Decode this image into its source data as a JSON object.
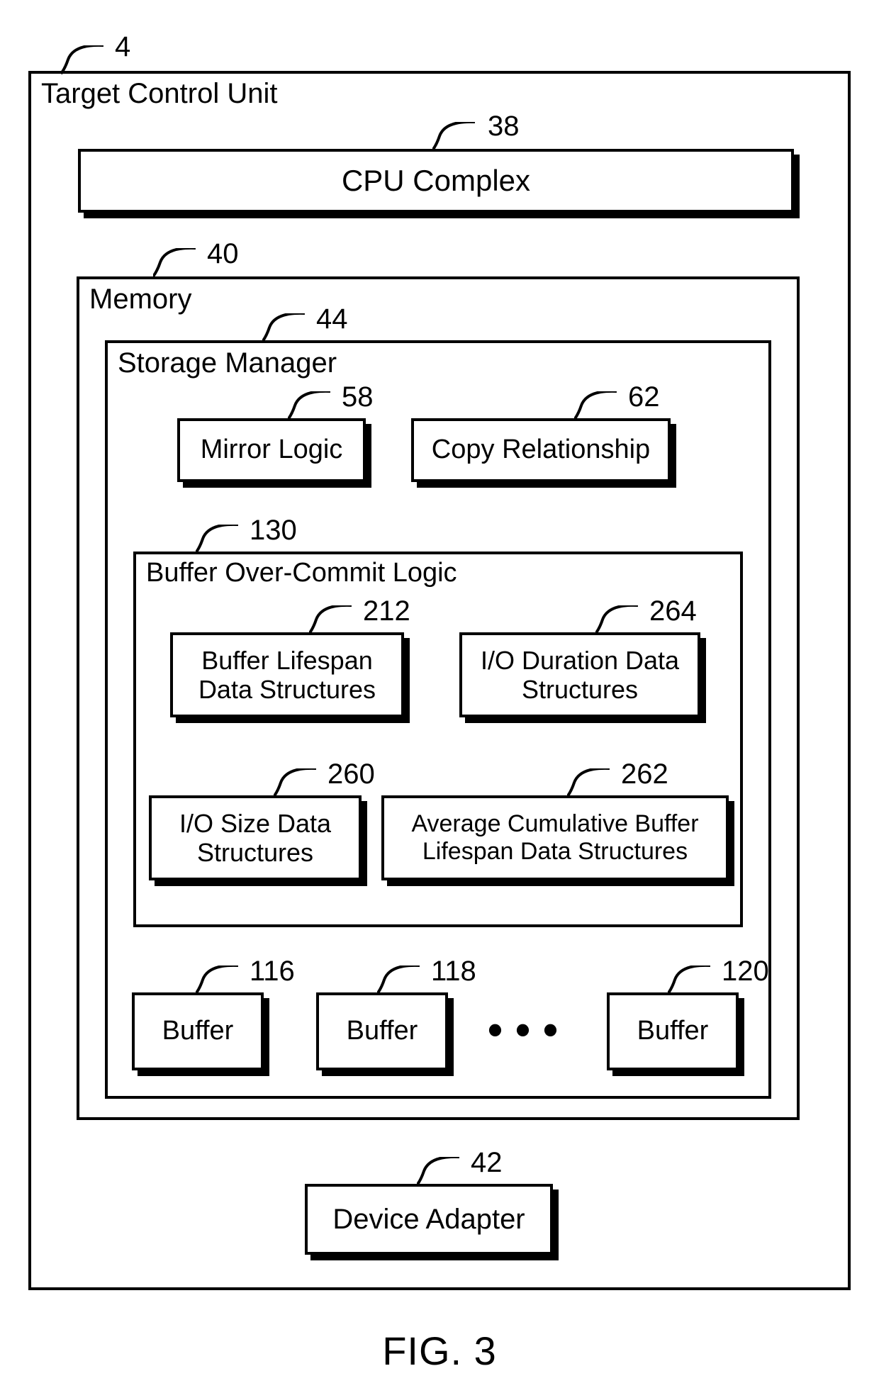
{
  "figure_caption": "FIG. 3",
  "target_control_unit": {
    "title": "Target Control Unit",
    "ref": "4",
    "cpu_complex": {
      "label": "CPU Complex",
      "ref": "38"
    },
    "memory": {
      "title": "Memory",
      "ref": "40",
      "storage_manager": {
        "title": "Storage Manager",
        "ref": "44",
        "mirror_logic": {
          "label": "Mirror Logic",
          "ref": "58"
        },
        "copy_relationship": {
          "label": "Copy Relationship",
          "ref": "62"
        },
        "buffer_overcommit_logic": {
          "title": "Buffer Over-Commit  Logic",
          "ref": "130",
          "buffer_lifespan_ds": {
            "label": "Buffer Lifespan Data Structures",
            "ref": "212"
          },
          "io_duration_ds": {
            "label": "I/O Duration Data Structures",
            "ref": "264"
          },
          "io_size_ds": {
            "label": "I/O Size Data Structures",
            "ref": "260"
          },
          "avg_cum_buffer_lifespan_ds": {
            "label": "Average Cumulative Buffer Lifespan Data Structures",
            "ref": "262"
          }
        },
        "buffers": [
          {
            "label": "Buffer",
            "ref": "116"
          },
          {
            "label": "Buffer",
            "ref": "118"
          },
          {
            "label": "Buffer",
            "ref": "120"
          }
        ]
      }
    },
    "device_adapter": {
      "label": "Device Adapter",
      "ref": "42"
    }
  }
}
